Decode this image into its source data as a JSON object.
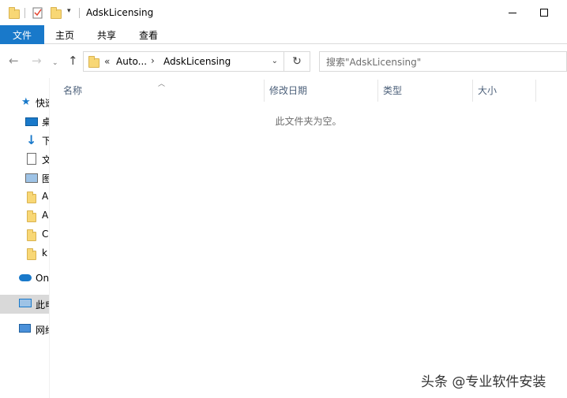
{
  "window": {
    "title": "AdskLicensing",
    "minimize_icon": "minimize-icon",
    "maximize_icon": "maximize-icon"
  },
  "ribbon": {
    "tabs": [
      {
        "label": "文件",
        "active": true
      },
      {
        "label": "主页"
      },
      {
        "label": "共享"
      },
      {
        "label": "查看"
      }
    ],
    "accent_color": "#1979ca"
  },
  "address_bar": {
    "overflow": "«",
    "segments": [
      "Auto...",
      "AdskLicensing"
    ],
    "separator": "›"
  },
  "search": {
    "placeholder": "搜索\"AdskLicensing\""
  },
  "nav_pane": {
    "items": [
      {
        "label": "快速访问",
        "icon": "star-icon"
      },
      {
        "label": "桌面",
        "icon": "desktop-icon"
      },
      {
        "label": "下载",
        "icon": "download-icon"
      },
      {
        "label": "文档",
        "icon": "document-icon"
      },
      {
        "label": "图片",
        "icon": "pictures-icon"
      },
      {
        "label": "A",
        "icon": "folder-icon"
      },
      {
        "label": "A",
        "icon": "folder-icon"
      },
      {
        "label": "C",
        "icon": "folder-icon"
      },
      {
        "label": "k",
        "icon": "folder-icon"
      },
      {
        "label": "OneDrive",
        "icon": "cloud-icon"
      },
      {
        "label": "此电脑",
        "icon": "computer-icon",
        "selected": true
      },
      {
        "label": "网络",
        "icon": "network-icon"
      }
    ]
  },
  "file_list": {
    "columns": [
      "名称",
      "修改日期",
      "类型",
      "大小"
    ],
    "empty_message": "此文件夹为空。"
  },
  "watermark": "头条 @专业软件安装"
}
